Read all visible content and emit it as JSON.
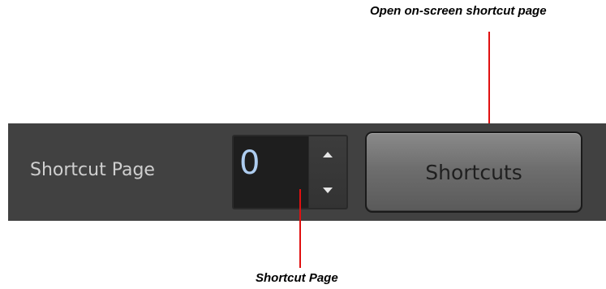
{
  "callouts": {
    "shortcuts_button": "Open on-screen shortcut page",
    "shortcut_page": "Shortcut Page"
  },
  "panel": {
    "label": "Shortcut Page",
    "page_value": "0",
    "button_label": "Shortcuts",
    "icons": {
      "increment": "arrow-up-icon",
      "decrement": "arrow-down-icon"
    }
  },
  "colors": {
    "panel_background": "#414141",
    "callout_line": "#e01010",
    "value_text": "#aecdf0"
  }
}
